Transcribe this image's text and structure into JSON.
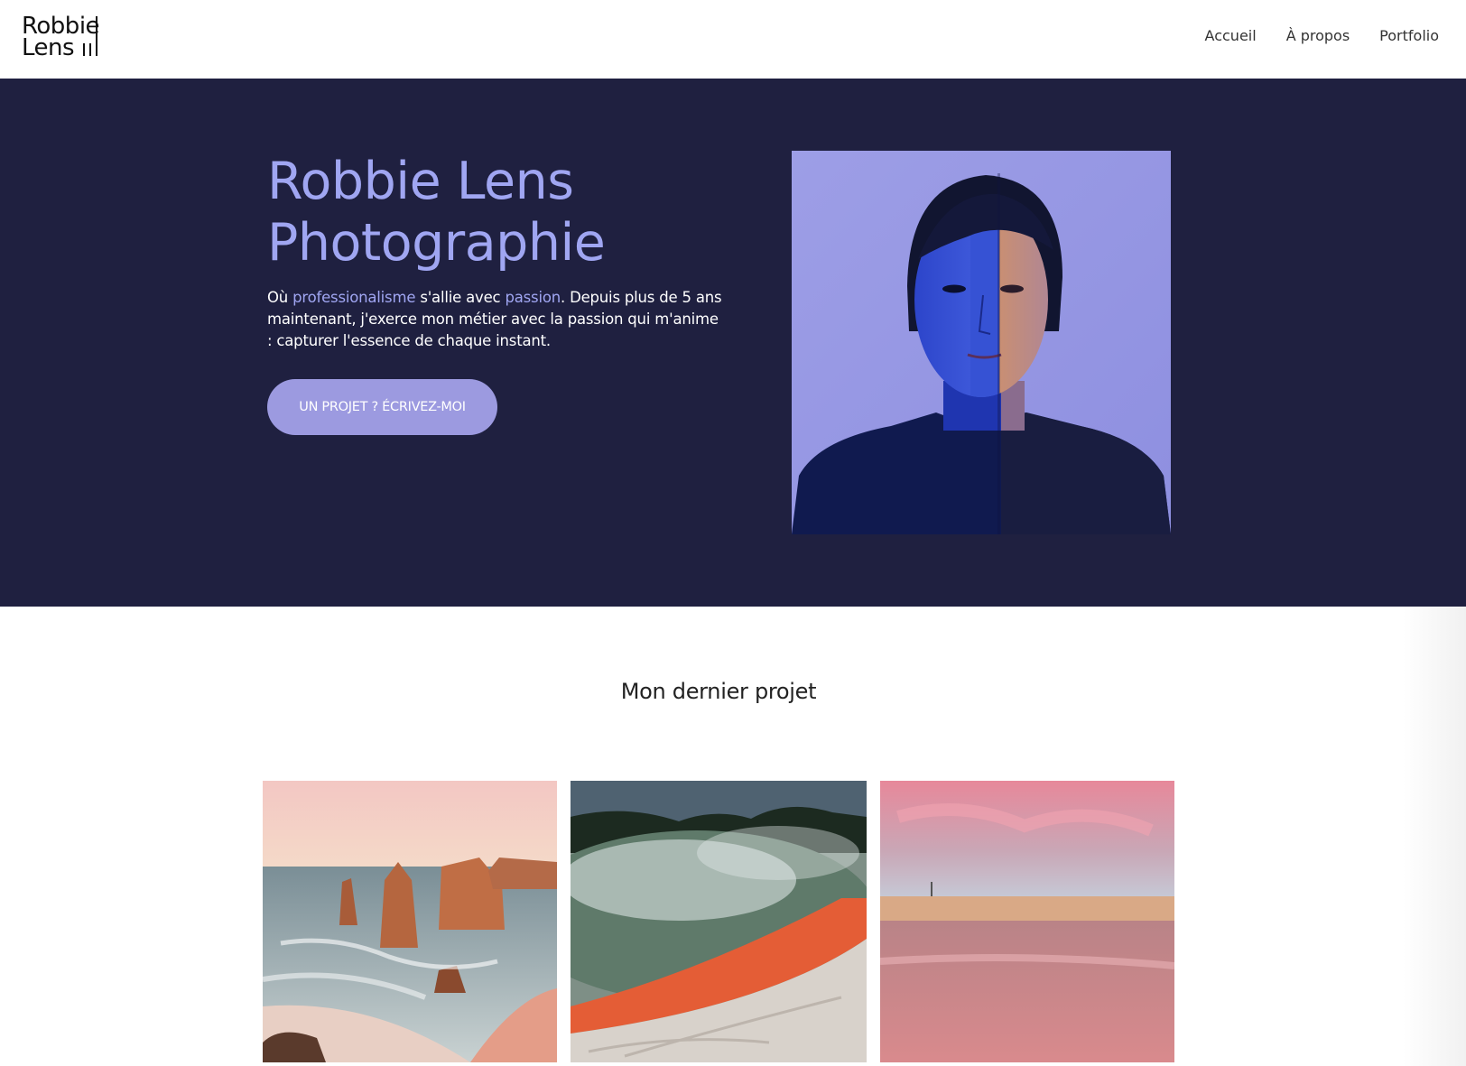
{
  "brand": {
    "logo_line1": "Robbie",
    "logo_line2": "Lens"
  },
  "nav": {
    "items": [
      {
        "label": "Accueil"
      },
      {
        "label": "À propos"
      },
      {
        "label": "Portfolio"
      }
    ]
  },
  "hero": {
    "title_line1": "Robbie Lens",
    "title_line2": "Photographie",
    "text_part1": "Où ",
    "text_highlight1": "professionalisme",
    "text_part2": " s'allie avec ",
    "text_highlight2": "passion",
    "text_part3": ". Depuis plus de 5 ans maintenant, j'exerce mon métier avec la passion qui m'anime : capturer l'essence de chaque instant.",
    "cta_label": "UN PROJET ? ÉCRIVEZ-MOI"
  },
  "project": {
    "title": "Mon dernier projet",
    "images": [
      {
        "icon": "sea-stacks-photo"
      },
      {
        "icon": "hot-spring-photo"
      },
      {
        "icon": "beach-sunset-photo"
      }
    ]
  },
  "colors": {
    "hero_bg": "#1f2040",
    "accent": "#a0a6f2",
    "button": "#9c9ae0"
  }
}
